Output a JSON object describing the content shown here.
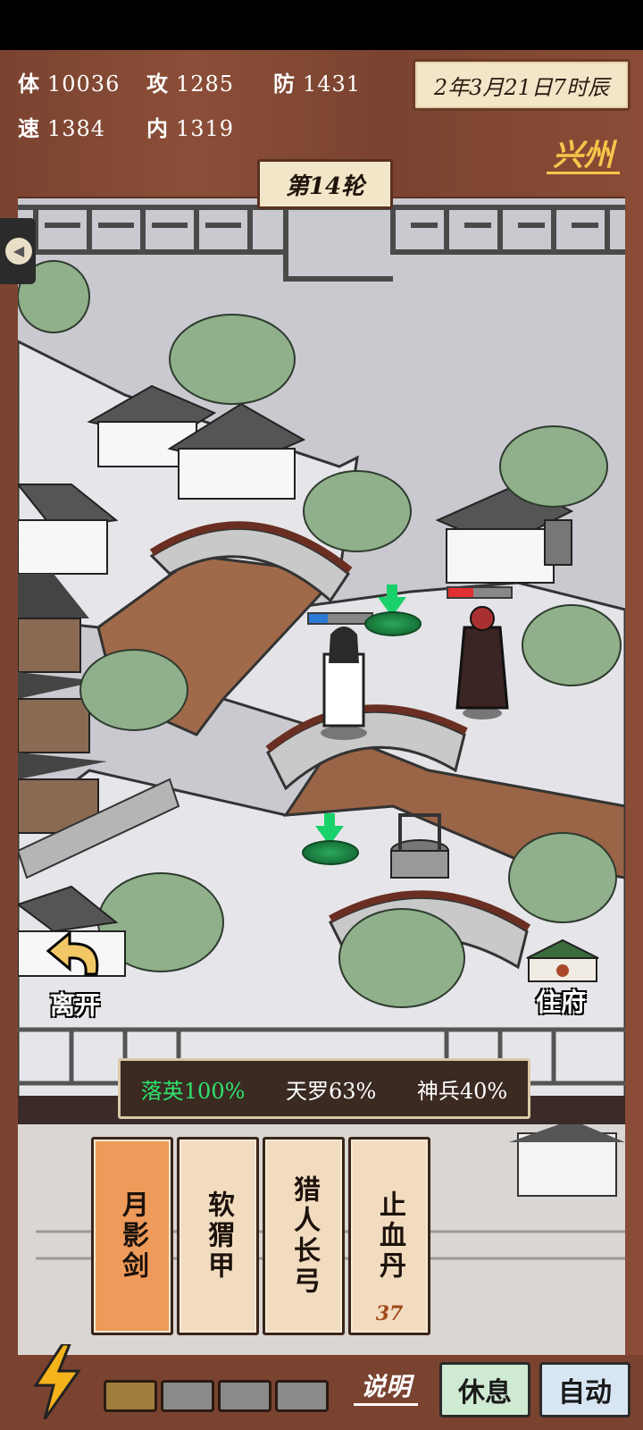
{
  "stats": {
    "hp_label": "体",
    "hp_value": "10036",
    "atk_label": "攻",
    "atk_value": "1285",
    "def_label": "防",
    "def_value": "1431",
    "spd_label": "速",
    "spd_value": "1384",
    "int_label": "内",
    "int_value": "1319"
  },
  "date": "2年3月21日7时辰",
  "city": "兴州",
  "round": "第14轮",
  "map": {
    "leave_label": "离开",
    "home_label": "住府",
    "player_hp_fraction": 0.3,
    "enemy_hp_fraction": 0.4
  },
  "skills": [
    {
      "text": "落英100%",
      "color": "#2fe36d"
    },
    {
      "text": "天罗63%",
      "color": "#ffffff"
    },
    {
      "text": "神兵40%",
      "color": "#ffffff"
    }
  ],
  "cards": [
    {
      "label": "月影剑",
      "active": true
    },
    {
      "label": "软猬甲",
      "active": false
    },
    {
      "label": "猎人长弓",
      "active": false
    },
    {
      "label": "止血丹",
      "count": "37",
      "active": false
    }
  ],
  "energy_slots_filled": 1,
  "energy_slots_total": 4,
  "buttons": {
    "help": "说明",
    "rest": "休息",
    "auto": "自动"
  }
}
